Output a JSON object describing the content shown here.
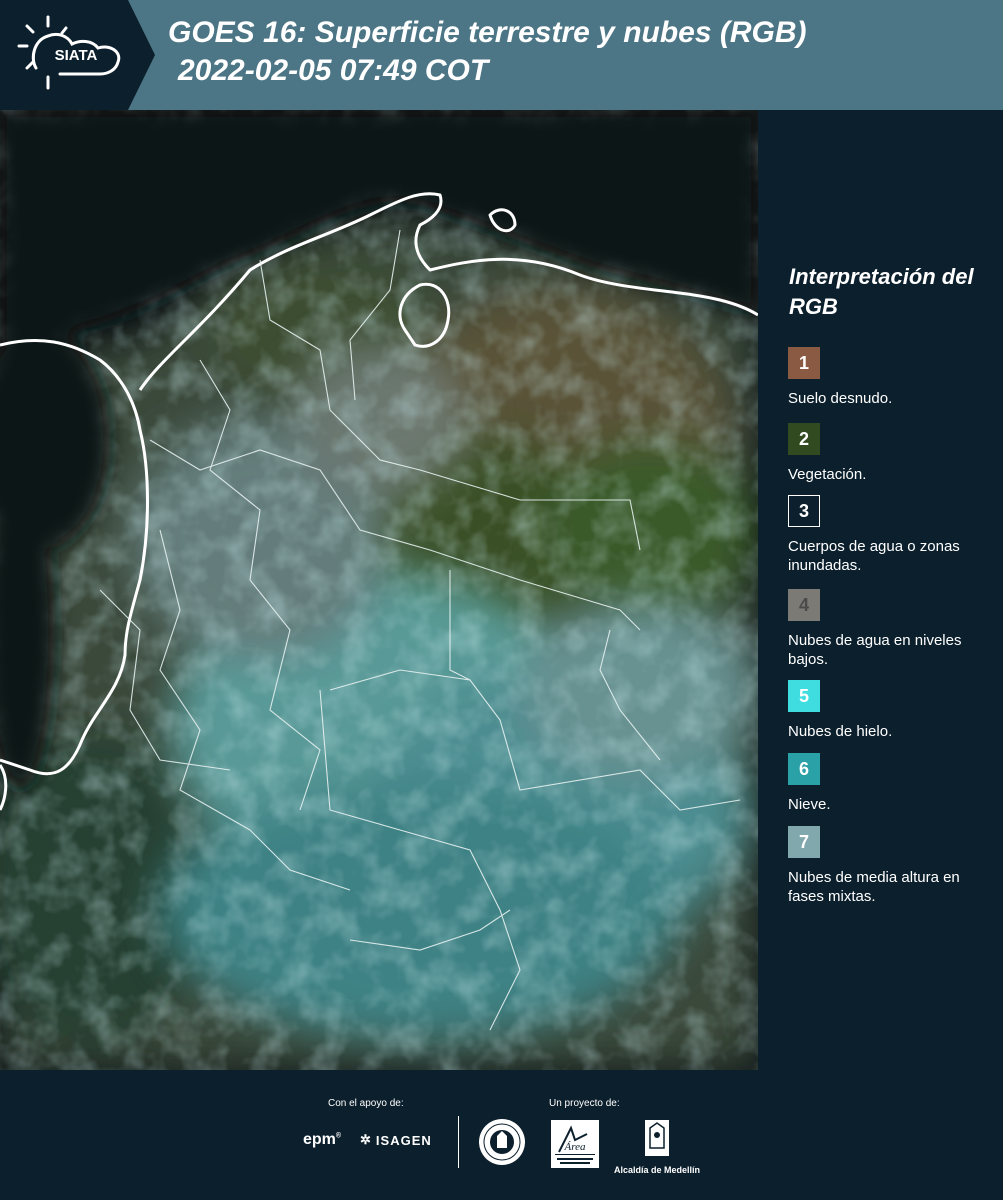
{
  "header": {
    "logo_text": "SIATA",
    "title_line1": "GOES 16: Superficie terrestre y nubes (RGB)",
    "title_line2": "2022-02-05 07:49 COT",
    "color": "#4c7686"
  },
  "legend": {
    "title": "Interpretación del RGB",
    "items": [
      {
        "number": "1",
        "label": "Suelo desnudo.",
        "color": "#8a5a43",
        "text_color": "#ffffff"
      },
      {
        "number": "2",
        "label": "Vegetación.",
        "color": "#324a1f",
        "text_color": "#ffffff"
      },
      {
        "number": "3",
        "label": "Cuerpos de agua o zonas inundadas.",
        "color": "#0c1f2c",
        "text_color": "#ffffff"
      },
      {
        "number": "4",
        "label": "Nubes de agua en niveles bajos.",
        "color": "#7c7a75",
        "text_color": "#4a4a4a"
      },
      {
        "number": "5",
        "label": "Nubes de hielo.",
        "color": "#3fdde0",
        "text_color": "#ffffff"
      },
      {
        "number": "6",
        "label": "Nieve.",
        "color": "#2aa1a6",
        "text_color": "#ffffff"
      },
      {
        "number": "7",
        "label": "Nubes de media altura en fases mixtas.",
        "color": "#81a8ad",
        "text_color": "#ffffff"
      }
    ]
  },
  "footer": {
    "support_label": "Con el apoyo de:",
    "project_label": "Un proyecto de:",
    "sponsor_epm": "epm",
    "sponsor_isagen": "ISAGEN",
    "partner_alcaldia": "Alcaldía de Medellín"
  }
}
